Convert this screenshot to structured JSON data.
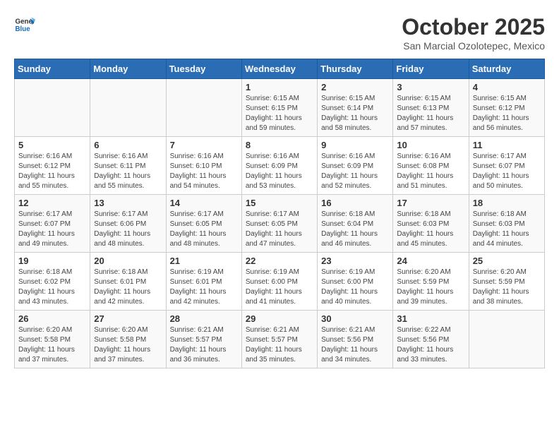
{
  "header": {
    "logo_line1": "General",
    "logo_line2": "Blue",
    "month": "October 2025",
    "location": "San Marcial Ozolotepec, Mexico"
  },
  "weekdays": [
    "Sunday",
    "Monday",
    "Tuesday",
    "Wednesday",
    "Thursday",
    "Friday",
    "Saturday"
  ],
  "weeks": [
    [
      {
        "day": "",
        "info": ""
      },
      {
        "day": "",
        "info": ""
      },
      {
        "day": "",
        "info": ""
      },
      {
        "day": "1",
        "info": "Sunrise: 6:15 AM\nSunset: 6:15 PM\nDaylight: 11 hours\nand 59 minutes."
      },
      {
        "day": "2",
        "info": "Sunrise: 6:15 AM\nSunset: 6:14 PM\nDaylight: 11 hours\nand 58 minutes."
      },
      {
        "day": "3",
        "info": "Sunrise: 6:15 AM\nSunset: 6:13 PM\nDaylight: 11 hours\nand 57 minutes."
      },
      {
        "day": "4",
        "info": "Sunrise: 6:15 AM\nSunset: 6:12 PM\nDaylight: 11 hours\nand 56 minutes."
      }
    ],
    [
      {
        "day": "5",
        "info": "Sunrise: 6:16 AM\nSunset: 6:12 PM\nDaylight: 11 hours\nand 55 minutes."
      },
      {
        "day": "6",
        "info": "Sunrise: 6:16 AM\nSunset: 6:11 PM\nDaylight: 11 hours\nand 55 minutes."
      },
      {
        "day": "7",
        "info": "Sunrise: 6:16 AM\nSunset: 6:10 PM\nDaylight: 11 hours\nand 54 minutes."
      },
      {
        "day": "8",
        "info": "Sunrise: 6:16 AM\nSunset: 6:09 PM\nDaylight: 11 hours\nand 53 minutes."
      },
      {
        "day": "9",
        "info": "Sunrise: 6:16 AM\nSunset: 6:09 PM\nDaylight: 11 hours\nand 52 minutes."
      },
      {
        "day": "10",
        "info": "Sunrise: 6:16 AM\nSunset: 6:08 PM\nDaylight: 11 hours\nand 51 minutes."
      },
      {
        "day": "11",
        "info": "Sunrise: 6:17 AM\nSunset: 6:07 PM\nDaylight: 11 hours\nand 50 minutes."
      }
    ],
    [
      {
        "day": "12",
        "info": "Sunrise: 6:17 AM\nSunset: 6:07 PM\nDaylight: 11 hours\nand 49 minutes."
      },
      {
        "day": "13",
        "info": "Sunrise: 6:17 AM\nSunset: 6:06 PM\nDaylight: 11 hours\nand 48 minutes."
      },
      {
        "day": "14",
        "info": "Sunrise: 6:17 AM\nSunset: 6:05 PM\nDaylight: 11 hours\nand 48 minutes."
      },
      {
        "day": "15",
        "info": "Sunrise: 6:17 AM\nSunset: 6:05 PM\nDaylight: 11 hours\nand 47 minutes."
      },
      {
        "day": "16",
        "info": "Sunrise: 6:18 AM\nSunset: 6:04 PM\nDaylight: 11 hours\nand 46 minutes."
      },
      {
        "day": "17",
        "info": "Sunrise: 6:18 AM\nSunset: 6:03 PM\nDaylight: 11 hours\nand 45 minutes."
      },
      {
        "day": "18",
        "info": "Sunrise: 6:18 AM\nSunset: 6:03 PM\nDaylight: 11 hours\nand 44 minutes."
      }
    ],
    [
      {
        "day": "19",
        "info": "Sunrise: 6:18 AM\nSunset: 6:02 PM\nDaylight: 11 hours\nand 43 minutes."
      },
      {
        "day": "20",
        "info": "Sunrise: 6:18 AM\nSunset: 6:01 PM\nDaylight: 11 hours\nand 42 minutes."
      },
      {
        "day": "21",
        "info": "Sunrise: 6:19 AM\nSunset: 6:01 PM\nDaylight: 11 hours\nand 42 minutes."
      },
      {
        "day": "22",
        "info": "Sunrise: 6:19 AM\nSunset: 6:00 PM\nDaylight: 11 hours\nand 41 minutes."
      },
      {
        "day": "23",
        "info": "Sunrise: 6:19 AM\nSunset: 6:00 PM\nDaylight: 11 hours\nand 40 minutes."
      },
      {
        "day": "24",
        "info": "Sunrise: 6:20 AM\nSunset: 5:59 PM\nDaylight: 11 hours\nand 39 minutes."
      },
      {
        "day": "25",
        "info": "Sunrise: 6:20 AM\nSunset: 5:59 PM\nDaylight: 11 hours\nand 38 minutes."
      }
    ],
    [
      {
        "day": "26",
        "info": "Sunrise: 6:20 AM\nSunset: 5:58 PM\nDaylight: 11 hours\nand 37 minutes."
      },
      {
        "day": "27",
        "info": "Sunrise: 6:20 AM\nSunset: 5:58 PM\nDaylight: 11 hours\nand 37 minutes."
      },
      {
        "day": "28",
        "info": "Sunrise: 6:21 AM\nSunset: 5:57 PM\nDaylight: 11 hours\nand 36 minutes."
      },
      {
        "day": "29",
        "info": "Sunrise: 6:21 AM\nSunset: 5:57 PM\nDaylight: 11 hours\nand 35 minutes."
      },
      {
        "day": "30",
        "info": "Sunrise: 6:21 AM\nSunset: 5:56 PM\nDaylight: 11 hours\nand 34 minutes."
      },
      {
        "day": "31",
        "info": "Sunrise: 6:22 AM\nSunset: 5:56 PM\nDaylight: 11 hours\nand 33 minutes."
      },
      {
        "day": "",
        "info": ""
      }
    ]
  ]
}
